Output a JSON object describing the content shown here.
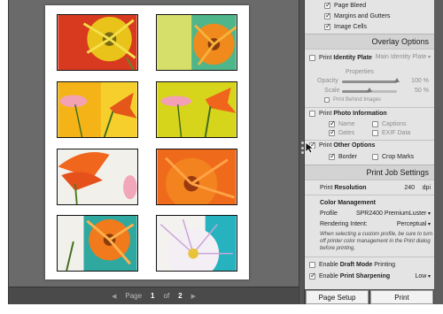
{
  "layout_panel": {
    "page_bleed": "Page Bleed",
    "margins_gutters": "Margins and Gutters",
    "image_cells": "Image Cells"
  },
  "overlay": {
    "header": "Overlay Options",
    "identity_plate_label": "Print",
    "identity_plate_bold": "Identity Plate",
    "identity_plate_value": "Main Identity Plate",
    "properties_label": "Properties",
    "opacity_label": "Opacity",
    "opacity_value": "100 %",
    "opacity_level": 1.0,
    "scale_label": "Scale",
    "scale_value": "50 %",
    "scale_level": 0.5,
    "print_behind_images": "Print Behind Images",
    "photo_info_label": "Print",
    "photo_info_bold": "Photo Information",
    "name": "Name",
    "captions": "Captions",
    "dates": "Dates",
    "exif": "EXIF Data",
    "other_options_label": "Print",
    "other_options_bold": "Other Options",
    "border": "Border",
    "crop_marks": "Crop Marks"
  },
  "print_job": {
    "header": "Print Job Settings",
    "resolution_label": "Print",
    "resolution_bold": "Resolution",
    "resolution_value": "240",
    "resolution_unit": "dpi",
    "color_management": "Color Management",
    "profile_label": "Profile",
    "profile_value": "SPR2400 PremiumLuster",
    "rendering_label": "Rendering Intent:",
    "rendering_value": "Perceptual",
    "note_line1": "When selecting a custom profile, be sure to turn",
    "note_line2": "off printer color management in the Print dialog",
    "note_line3": "before printing.",
    "draft_prefix": "Enable",
    "draft_bold": "Draft Mode",
    "draft_suffix": "Printing",
    "sharpen_prefix": "Enable",
    "sharpen_bold": "Print Sharpening",
    "sharpen_value": "Low"
  },
  "buttons": {
    "page_setup": "Page Setup",
    "print": "Print"
  },
  "pager": {
    "page_label": "Page",
    "current": "1",
    "of_label": "of",
    "total": "2",
    "prev": "◀",
    "next": "▶"
  },
  "colors": {
    "panel_bg": "#e4e4e4",
    "canvas_bg": "#6a6a6a",
    "frame_bg": "#5e5e5e"
  }
}
